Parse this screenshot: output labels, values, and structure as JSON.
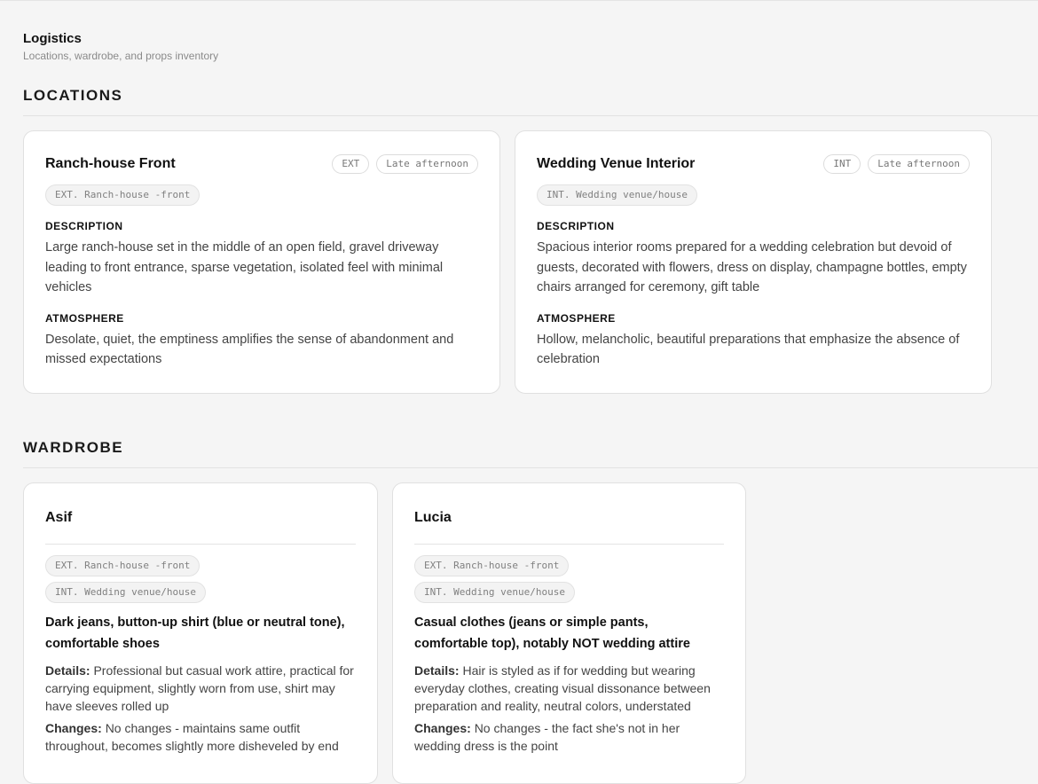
{
  "page": {
    "title": "Logistics",
    "subtitle": "Locations, wardrobe, and props inventory"
  },
  "sections": {
    "locations": "LOCATIONS",
    "wardrobe": "WARDROBE"
  },
  "locations": [
    {
      "name": "Ranch-house Front",
      "int_ext": "EXT",
      "time": "Late afternoon",
      "slug": "EXT. Ranch-house -front",
      "description_label": "DESCRIPTION",
      "description": "Large ranch-house set in the middle of an open field, gravel driveway leading to front entrance, sparse vegetation, isolated feel with minimal vehicles",
      "atmosphere_label": "ATMOSPHERE",
      "atmosphere": "Desolate, quiet, the emptiness amplifies the sense of abandonment and missed expectations"
    },
    {
      "name": "Wedding Venue Interior",
      "int_ext": "INT",
      "time": "Late afternoon",
      "slug": "INT. Wedding venue/house",
      "description_label": "DESCRIPTION",
      "description": "Spacious interior rooms prepared for a wedding celebration but devoid of guests, decorated with flowers, dress on display, champagne bottles, empty chairs arranged for ceremony, gift table",
      "atmosphere_label": "ATMOSPHERE",
      "atmosphere": "Hollow, melancholic, beautiful preparations that emphasize the absence of celebration"
    }
  ],
  "wardrobe": [
    {
      "name": "Asif",
      "slugs": [
        "EXT. Ranch-house -front",
        "INT. Wedding venue/house"
      ],
      "summary": "Dark jeans, button-up shirt (blue or neutral tone), comfortable shoes",
      "details_label": "Details:",
      "details": "Professional but casual work attire, practical for carrying equipment, slightly worn from use, shirt may have sleeves rolled up",
      "changes_label": "Changes:",
      "changes": "No changes - maintains same outfit throughout, becomes slightly more disheveled by end"
    },
    {
      "name": "Lucia",
      "slugs": [
        "EXT. Ranch-house -front",
        "INT. Wedding venue/house"
      ],
      "summary": "Casual clothes (jeans or simple pants, comfortable top), notably NOT wedding attire",
      "details_label": "Details:",
      "details": "Hair is styled as if for wedding but wearing everyday clothes, creating visual dissonance between preparation and reality, neutral colors, understated",
      "changes_label": "Changes:",
      "changes": "No changes - the fact she's not in her wedding dress is the point"
    }
  ]
}
